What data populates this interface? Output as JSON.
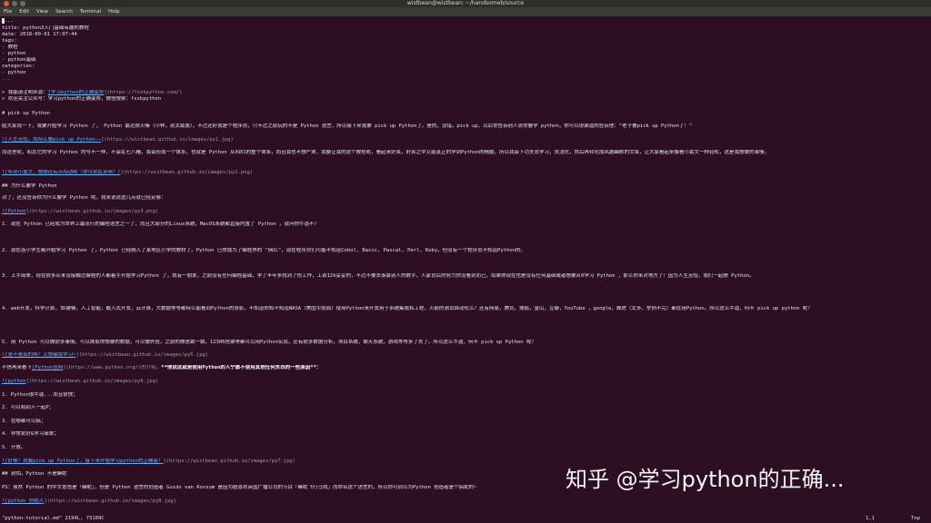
{
  "window": {
    "title": "wistbean@wistbean: ~/handsomeb/source",
    "colors": {
      "background": "#2c0f22",
      "titlebar": "#2d2d2a",
      "close": "#e05a2a",
      "link": "#64b4ff"
    }
  },
  "menu": [
    "File",
    "Edit",
    "View",
    "Search",
    "Terminal",
    "Help"
  ],
  "lines": {
    "l1": "---",
    "l2": "title: python3入门基础有趣的教程",
    "l3": "date: 2018-09-01 17:07:44",
    "l4": "tags:",
    "l5": "    - 教程",
    "l6": "    - python",
    "l7": "    - python基础",
    "l8": "categories:",
    "l9": "    - python",
    "l10": "---",
    "l11a": "> 我能请注明来源：",
    "l11b": "[学习python的正确姿势",
    "l11c": "](https://fxxkpython.com/)",
    "l12": "> 欢迎关注公众号：学习python的正确姿势，微信搜索：fxxkpython",
    "l13": "# pick up Python",
    "l14": "给大家说一下，我要开始学习 Python 了， Python 最近很火嘛（小样，别太膨胀），不过还好我是个程序员，只不过之前玩的不是 Python 语言，所以接下来我要 pick up Python了。是的，没错，pick up，以后你告诉别人说你要学 python，你可以很装逼的告诉他：\"老子要pick up Python了！\"",
    "l15a": "![人生苦短，我特么要pick up Python——",
    "l15b": "](https://wistbean.github.io/images/py1.jpg)",
    "l16": "而这里呢，和其它的学习 Python 的号不一样，不会乱七八糟，我会形成一个体系，也就是 Python 从0到1的整个体系，而且我也不想严肃，我要让我的这个教程呢，看起来好笑，好笑之中又能真正的学到Python的精髓，所以我会下功夫去学习，去消化，然后再转化成风趣幽默的文章，让大家看起来像看小黄文一样轻松，这是我想做的事情。",
    "l17a": "![听到小黄文，想想还有点鸡动呢（你可别乱来啊！）",
    "l17b": "](https://wistbean.github.io/images/py2.png)",
    "l18": "## 为什么要学 Python",
    "l19": "对了，还没告诉你为什么要学 Python 呢，我来说说这几点就已经足够：",
    "l20a": "![Python",
    "l20b": "](https://wistbean.github.io/images/py3.png)",
    "l21": "1. 现在 Python 已经成为世界上最流行的编程语言之一了，而且大部分的Linux系统，MacOS系统都直接内置了 Python ，就问你牛逼不？",
    "l22": "2. 现在连小学生都开始学习 Python 了，Python 已经纳入了某地区小学的教材了。Python 已然成为了编程界的 \"网红\"，现在程序员们可能不知道Cobol, Basic, Pascal, Perl, Ruby，但没有一个程序员不知道Python的。",
    "l23": "3. 上手简单，现在很多从来没接触过编程的人都着手开始学习Python 了，我有一朋友，之前没有任何编程基础，学了半年多找到了份工作，工资12k妥妥的，不过不要去羡慕别人的数字，人家背后的努力你没看到而已，如果你现在也是没有任何基础或者想要从0学习 Python ，那么你来对地方了！因为人生苦短，我们一起撩 Python。",
    "l24": "4. web开发，科学计算，3D建模，人工智能，嵌入式开发，云计算，大数据等等都特么能看到Python的身影，不知道你知不知道NASA（美国宇航局）使用Python来开发用于系统集成和工程，火箭的测试自动化么？还有网易，腾讯，搜狐，金山，豆瓣，YouTube ，google，雅虎（太多，举例不完）都在用Python。所以这么牛逼，何不 pick up python 呢？",
    "l25": "5. 用 Python 可以做很多事情，可以爬取你想要的数据，可以做外挂，之前的微信跳一跳，12306抢票等都可以用Python实现，还有很多数据分析，项目系统，聊天系统，游戏等等多了去了。所以这么牛逼，何不 pick up Python 呢？",
    "l26a": "![是不是真的啊？又想骗我学习~",
    "l26b": "](https://wistbean.github.io/images/py5.jpg)",
    "l27a": "不信再来看下",
    "l27b": "[Python官网",
    "l27c": "](https://www.python.org/)的介绍，",
    "l27d": "**他说这就是使用Python的人宁愿不使用其他任何东西的一些原因**：",
    "l28a": "![python",
    "l28b": "](https://wistbean.github.io/images/py6.jpg)",
    "l29": "1. Python很牛逼...而且很快；",
    "l30": "2. 可以和别人一起P；",
    "l31": "3. 在哪都可以搞；",
    "l32": "4. 非常友好&学习简单；",
    "l33": "5. 开放。",
    "l34a": "![好棒！我要pick up Python了，接下来开始学习python的正确姿！",
    "l34b": "](https://wistbean.github.io/images/py7.jpg)",
    "l35": "## 别怕，Python 不是蟒蛇",
    "l36": "PS：虽然 Python 的中文意思是「蟒蛇」，但是 Python 语言的创造者 Guido van Rossum 是因为超喜欢英国广播公司的节目「蟒蛇飞行马戏」而命名这个语言的，所以你可别以为Python 创造者是个搞蛇的~",
    "l37a": "![python 创始人",
    "l37b": "](https://wistbean.github.io/images/py8.jpg)"
  },
  "watermark": "知乎 @学习python的正确...",
  "status": {
    "file": "\"python-tutorial.md\" 2194L, 73109C",
    "position": "1,1",
    "scroll": "Top"
  }
}
